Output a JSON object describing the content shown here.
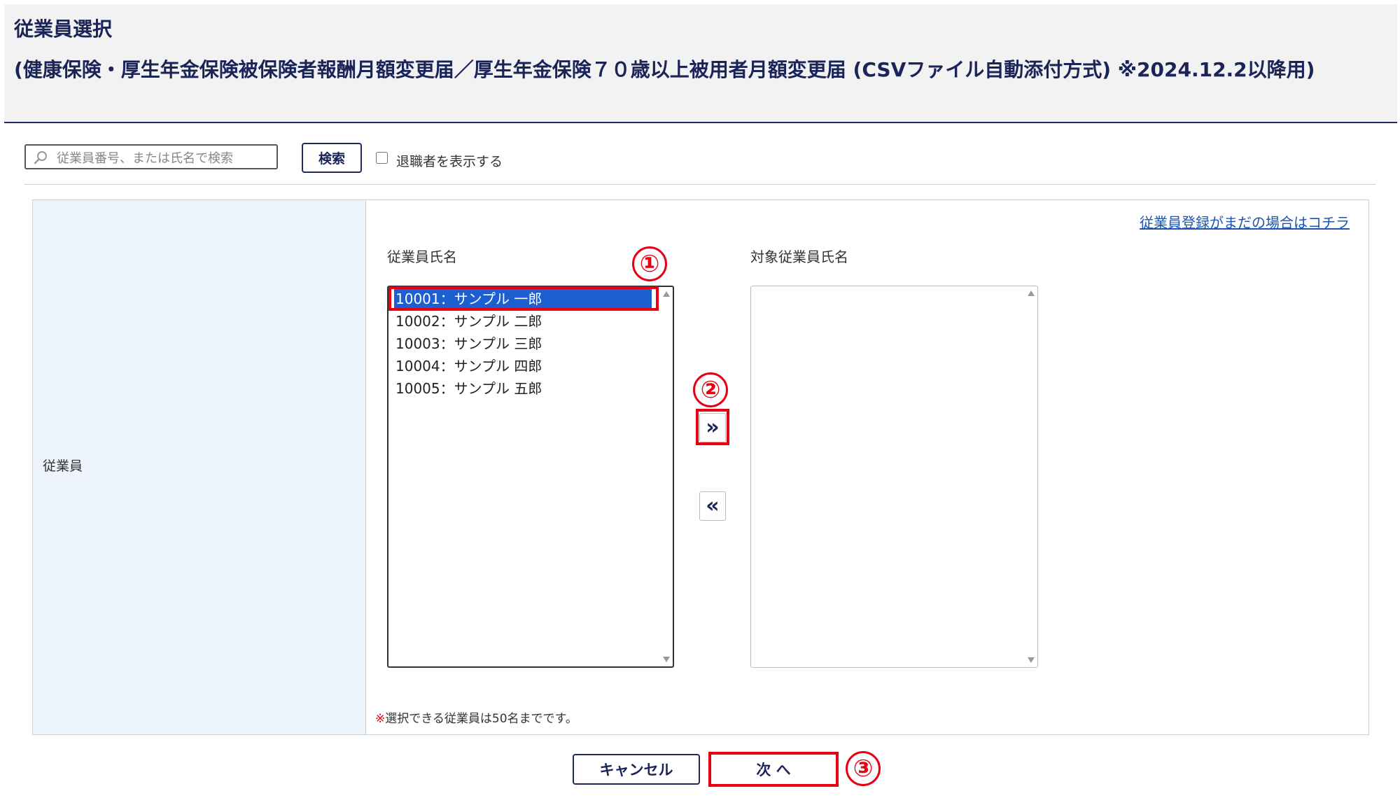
{
  "header": {
    "title": "従業員選択",
    "subtitle": "(健康保険・厚生年金保険被保険者報酬月額変更届／厚生年金保険７０歳以上被用者月額変更届 (CSVファイル自動添付方式) ※2024.12.2以降用)"
  },
  "search": {
    "placeholder": "従業員番号、または氏名で検索",
    "value": "",
    "button_label": "検索",
    "icon": "search-icon",
    "show_retired_label": "退職者を表示する",
    "show_retired_checked": false
  },
  "panel": {
    "row_label": "従業員",
    "register_link": "従業員登録がまだの場合はコチラ",
    "left_heading": "従業員氏名",
    "right_heading": "対象従業員氏名",
    "employees": [
      {
        "label": "10001：サンプル 一郎",
        "selected": true
      },
      {
        "label": "10002：サンプル 二郎",
        "selected": false
      },
      {
        "label": "10003：サンプル 三郎",
        "selected": false
      },
      {
        "label": "10004：サンプル 四郎",
        "selected": false
      },
      {
        "label": "10005：サンプル 五郎",
        "selected": false
      }
    ],
    "targets": [],
    "add_label": "»",
    "remove_label": "«",
    "note_mark": "※",
    "note": "選択できる従業員は50名までです。"
  },
  "footer": {
    "cancel_label": "キャンセル",
    "next_label": "次 へ"
  },
  "annotations": [
    "①",
    "②",
    "③"
  ],
  "colors": {
    "accent": "#e60012",
    "selection": "#1b5fd0",
    "navy": "#1a2459",
    "link": "#1a55b0",
    "label_cell": "#eef4fb"
  }
}
